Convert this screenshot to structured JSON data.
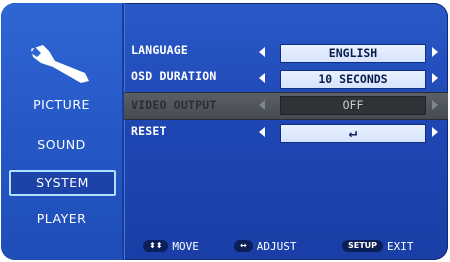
{
  "sidebar": {
    "items": [
      {
        "label": "PICTURE"
      },
      {
        "label": "SOUND"
      },
      {
        "label": "SYSTEM"
      },
      {
        "label": "PLAYER"
      }
    ],
    "selected": "SYSTEM"
  },
  "settings": [
    {
      "label": "LANGUAGE",
      "value": "ENGLISH",
      "enabled": true
    },
    {
      "label": "OSD DURATION",
      "value": "10 SECONDS",
      "enabled": true
    },
    {
      "label": "VIDEO OUTPUT",
      "value": "OFF",
      "enabled": false
    },
    {
      "label": "RESET",
      "value": "↵",
      "enabled": true
    }
  ],
  "footer": {
    "move": {
      "key": "⬍⬍",
      "label": "MOVE"
    },
    "adjust": {
      "key": "↔",
      "label": "ADJUST"
    },
    "exit": {
      "key": "SETUP",
      "label": "EXIT"
    }
  },
  "colors": {
    "background": "#1f47b4",
    "sidebar": "#2558c6",
    "value_box": "#d5e4fb",
    "disabled_band": "#4f545c",
    "selected_border": "#aee0ff"
  },
  "icons": {
    "category": "wrench-icon"
  }
}
